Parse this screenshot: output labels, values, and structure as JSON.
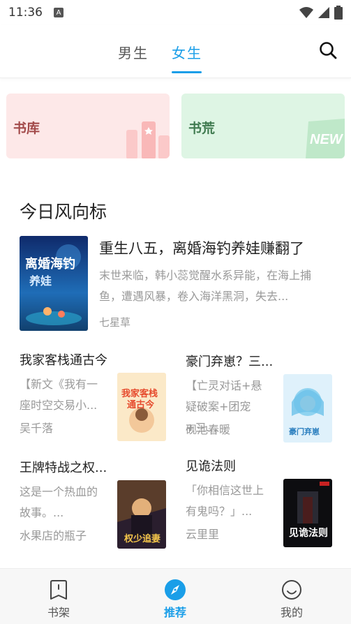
{
  "status": {
    "time": "11:36",
    "notif": "A"
  },
  "tabs": [
    {
      "label": "男生"
    },
    {
      "label": "女生"
    }
  ],
  "banners": [
    {
      "label": "书库"
    },
    {
      "label": "书荒"
    }
  ],
  "section": {
    "title": "今日风向标"
  },
  "featured": {
    "title": "重生八五，离婚海钓养娃赚翻了",
    "desc": "末世来临，韩小蕊觉醒水系异能，在海上捕鱼，遭遇风暴，卷入海洋黑洞，失去...",
    "author": "七星草"
  },
  "books": [
    {
      "title": "我家客栈通古今",
      "desc": "【新文《我有一座时空交易小...",
      "author": "吴千落"
    },
    {
      "title": "豪门弃崽？三...",
      "desc": "【亡灵对话+悬疑破案+团宠+三...",
      "author": "砚池春暖"
    },
    {
      "title": "王牌特战之权...",
      "desc": "这是一个热血的故事。...",
      "author": "水果店的瓶子"
    },
    {
      "title": "见诡法则",
      "desc": "「你相信这世上有鬼吗？」...",
      "author": "云里里"
    }
  ],
  "bottom_nav": [
    {
      "label": "书架",
      "icon": "bookshelf-icon"
    },
    {
      "label": "推荐",
      "icon": "compass-icon"
    },
    {
      "label": "我的",
      "icon": "profile-icon"
    }
  ],
  "colors": {
    "accent": "#1a9ee8",
    "library_bg": "#fde8e8",
    "shortage_bg": "#def5e4"
  }
}
